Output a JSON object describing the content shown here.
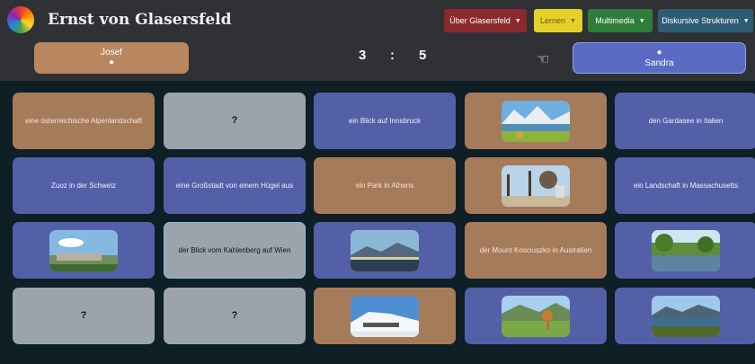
{
  "app": {
    "title": "Ernst von Glasersfeld"
  },
  "nav": [
    {
      "label": "Über Glasersfeld",
      "color": "#8b2a2e"
    },
    {
      "label": "Lernen",
      "color": "#e3d02a"
    },
    {
      "label": "Multimedia",
      "color": "#2f7d3b"
    },
    {
      "label": "Diskursive Strukturen",
      "color": "#2e5d73"
    }
  ],
  "players": {
    "left": {
      "name": "Josef",
      "icon": "user-icon"
    },
    "right": {
      "name": "Sandra",
      "icon": "user-icon"
    }
  },
  "score": {
    "left": "3",
    "separator": ":",
    "right": "5"
  },
  "turn_icon": "hand-pointing-left-icon",
  "colors": {
    "brown": "#a67b5a",
    "blue": "#5360a8",
    "gray": "#9aa4aa",
    "background": "#0e1f26"
  },
  "cards": [
    {
      "kind": "text",
      "style": "brown",
      "text": "eine österreichische Alpenlandschaft"
    },
    {
      "kind": "hidden",
      "style": "gray",
      "text": "?"
    },
    {
      "kind": "text",
      "style": "blue",
      "text": "ein Blick auf Innsbruck"
    },
    {
      "kind": "image",
      "style": "brown",
      "scene": "alpine-lake-photo"
    },
    {
      "kind": "text",
      "style": "blue",
      "text": "den Gardasee in Italien"
    },
    {
      "kind": "text",
      "style": "blue",
      "text": "Zuoz in der Schweiz"
    },
    {
      "kind": "text",
      "style": "blue",
      "text": "eine Großstadt von einem Hügel aus"
    },
    {
      "kind": "text",
      "style": "brown",
      "text": "ein Park in Athens"
    },
    {
      "kind": "image",
      "style": "brown",
      "scene": "park-photo"
    },
    {
      "kind": "text",
      "style": "blue",
      "text": "ein Landschaft in Massachusetts"
    },
    {
      "kind": "image",
      "style": "blue",
      "scene": "city-hill-photo"
    },
    {
      "kind": "text",
      "style": "gray",
      "text": "der Blick vom Kahlenberg auf Wien",
      "selected": true
    },
    {
      "kind": "image",
      "style": "blue",
      "scene": "mountain-city-photo"
    },
    {
      "kind": "text",
      "style": "brown",
      "text": "der Mount Kosciuszko in Australien"
    },
    {
      "kind": "image",
      "style": "blue",
      "scene": "river-landscape-photo"
    },
    {
      "kind": "hidden",
      "style": "gray",
      "text": "?"
    },
    {
      "kind": "hidden",
      "style": "gray",
      "text": "?"
    },
    {
      "kind": "image",
      "style": "brown",
      "scene": "snow-mountain-photo"
    },
    {
      "kind": "image",
      "style": "blue",
      "scene": "green-valley-photo"
    },
    {
      "kind": "image",
      "style": "blue",
      "scene": "lake-mountains-photo"
    }
  ]
}
